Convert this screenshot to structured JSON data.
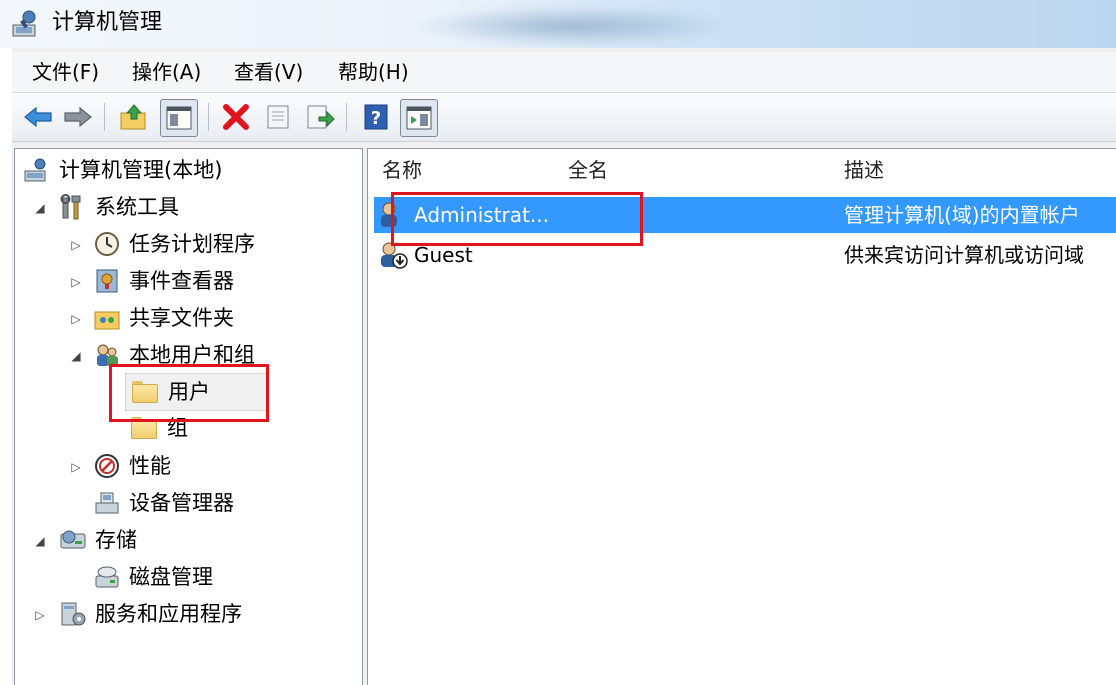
{
  "window": {
    "title": "计算机管理"
  },
  "menu": [
    {
      "label": "文件(F)"
    },
    {
      "label": "操作(A)"
    },
    {
      "label": "查看(V)"
    },
    {
      "label": "帮助(H)"
    }
  ],
  "toolbar": {
    "buttons": [
      "back-arrow-icon",
      "forward-arrow-icon",
      "up-folder-icon",
      "show-tree-icon",
      "delete-icon",
      "properties-icon",
      "export-icon",
      "help-icon",
      "show-action-pane-icon"
    ],
    "delete_color": "#e0141e",
    "help_color": "#2f5fb3"
  },
  "tree": {
    "root": "计算机管理(本地)",
    "system_tools": "系统工具",
    "task_scheduler": "任务计划程序",
    "event_viewer": "事件查看器",
    "shared_folders": "共享文件夹",
    "local_users_groups": "本地用户和组",
    "users": "用户",
    "groups": "组",
    "performance": "性能",
    "device_manager": "设备管理器",
    "storage": "存储",
    "disk_management": "磁盘管理",
    "services_apps": "服务和应用程序"
  },
  "list": {
    "columns": {
      "name": "名称",
      "fullname": "全名",
      "description": "描述"
    },
    "rows": [
      {
        "name": "Administrat...",
        "fullname": "",
        "description": "管理计算机(域)的内置帐户"
      },
      {
        "name": "Guest",
        "fullname": "",
        "description": "供来宾访问计算机或访问域"
      }
    ]
  },
  "colors": {
    "selection": "#3399ff",
    "highlight_box": "#e0141e"
  }
}
